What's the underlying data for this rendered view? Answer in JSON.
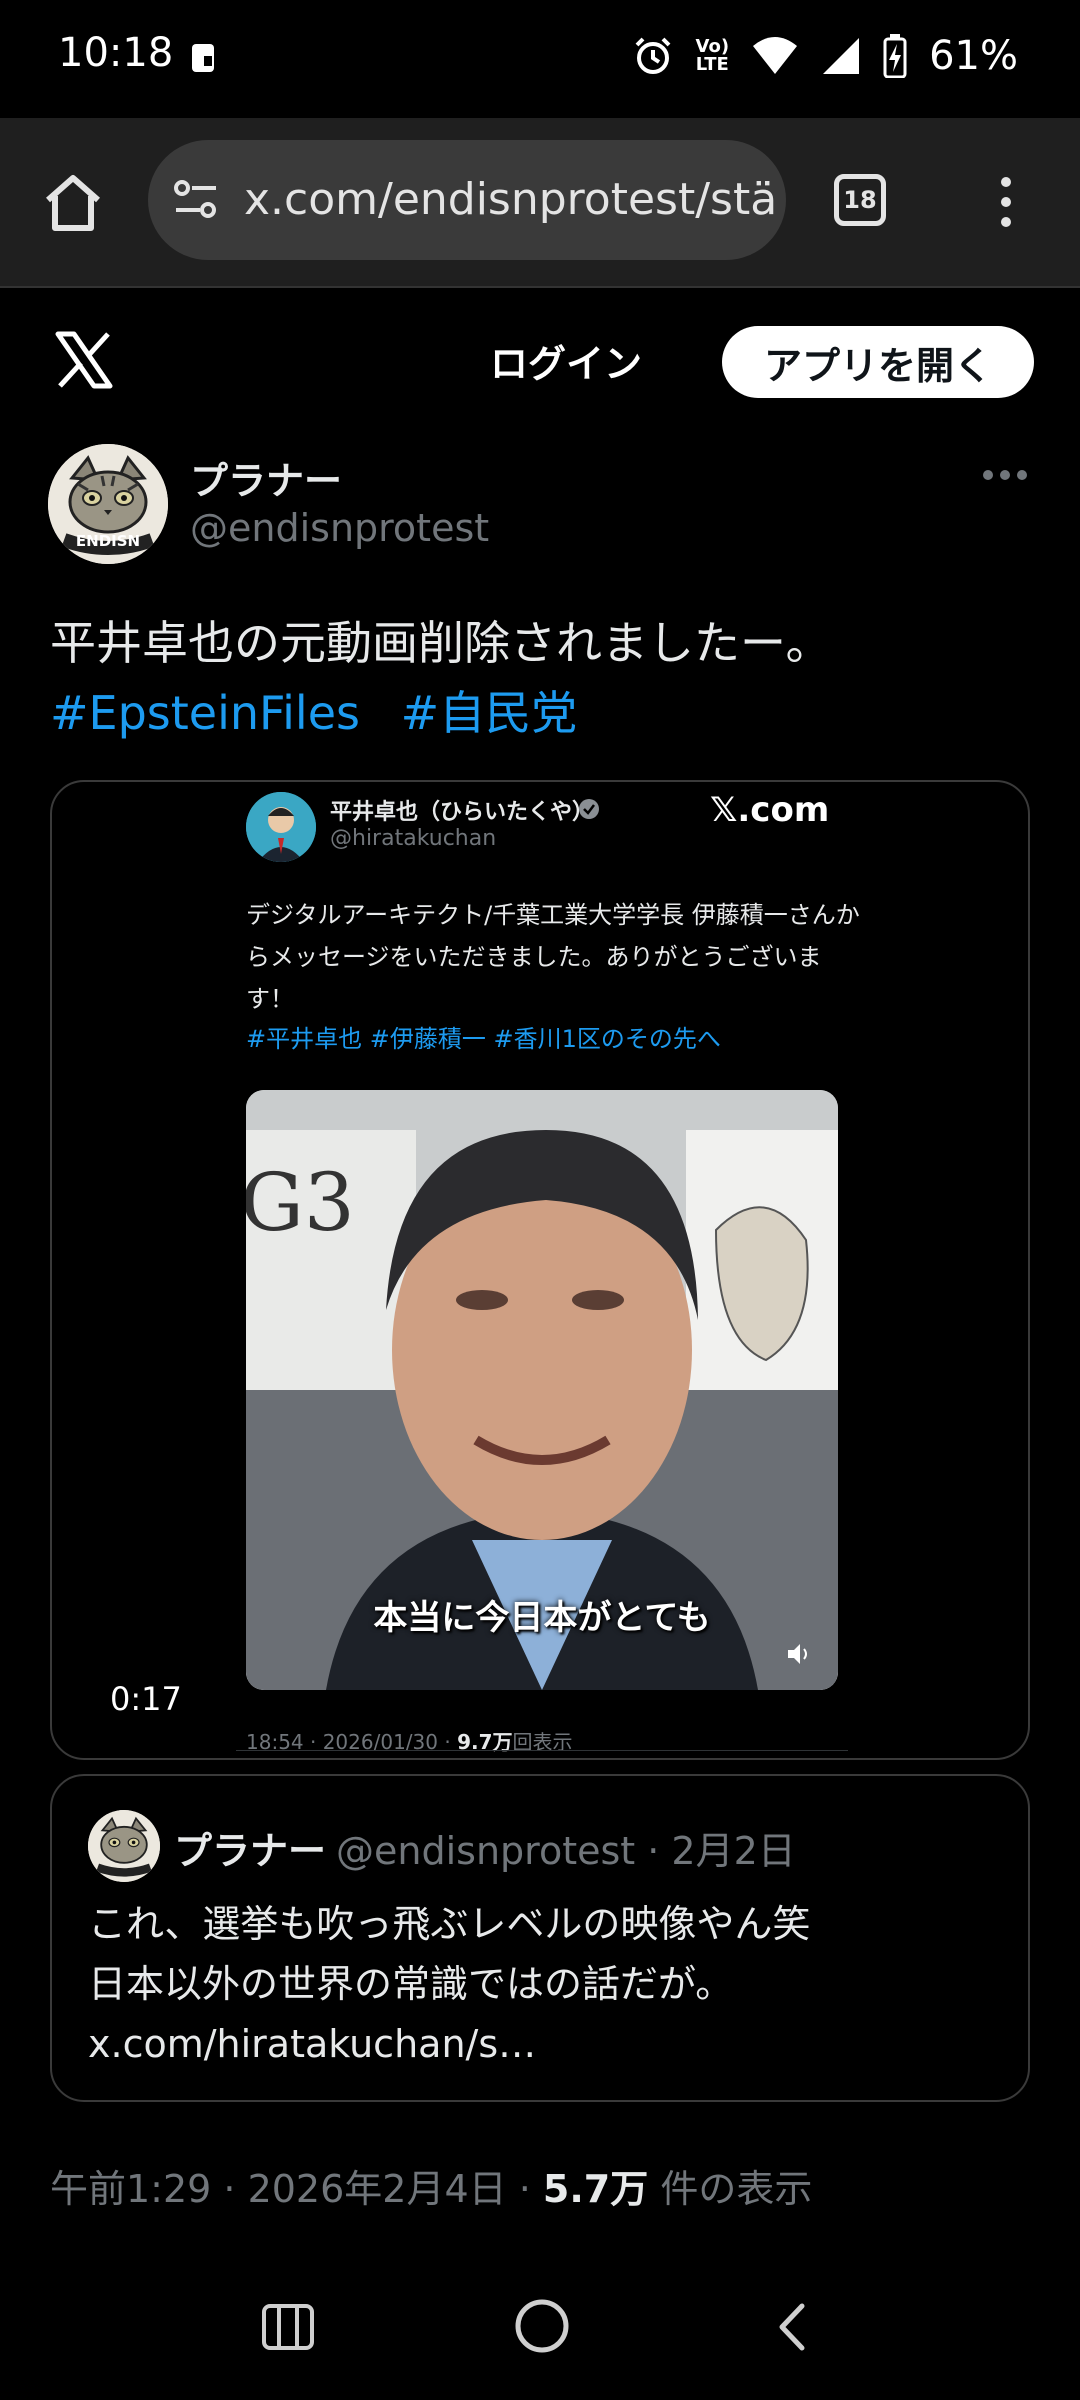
{
  "status_bar": {
    "time": "10:18",
    "battery": "61%",
    "volte": [
      "Vo)",
      "LTE"
    ]
  },
  "browser": {
    "url": "x.com/endisnprotest/stä",
    "tab_count": "18"
  },
  "x_header": {
    "login": "ログイン",
    "open_app": "アプリを開く"
  },
  "tweet": {
    "author_name": "プラナー",
    "author_handle": "@endisnprotest",
    "text": "平井卓也の元動画削除されましたー。",
    "hashtags": [
      "#EpsteinFiles",
      "#自民党"
    ],
    "timestamp": "午前1:29 · 2026年2月4日 ·",
    "views": "5.7万",
    "views_suffix": "件の表示"
  },
  "media": {
    "duration": "0:17",
    "inner_post": {
      "name": "平井卓也（ひらいたくや）",
      "handle": "@hiratakuchan",
      "brand": "𝕏.com",
      "body": "デジタルアーキテクト/千葉工業大学学長 伊藤積一さんからメッセージをいただきました。ありがとうございます！",
      "tags": "#平井卓也 #伊藤積一 #香川1区のその先へ",
      "video_caption": "本当に今日本がとても",
      "meta_prefix": "18:54 · 2026/01/30 ·",
      "meta_views": "9.7万",
      "meta_suffix": "回表示"
    }
  },
  "quote": {
    "name": "プラナー",
    "handle_date": "@endisnprotest · 2月2日",
    "line1": "これ、選挙も吹っ飛ぶレベルの映像やん笑",
    "line2": "日本以外の世界の常識ではの話だが。",
    "line3": "x.com/hiratakuchan/s…"
  },
  "colors": {
    "link": "#1d9bf0",
    "secondary_text": "#71767b",
    "background": "#000000"
  }
}
